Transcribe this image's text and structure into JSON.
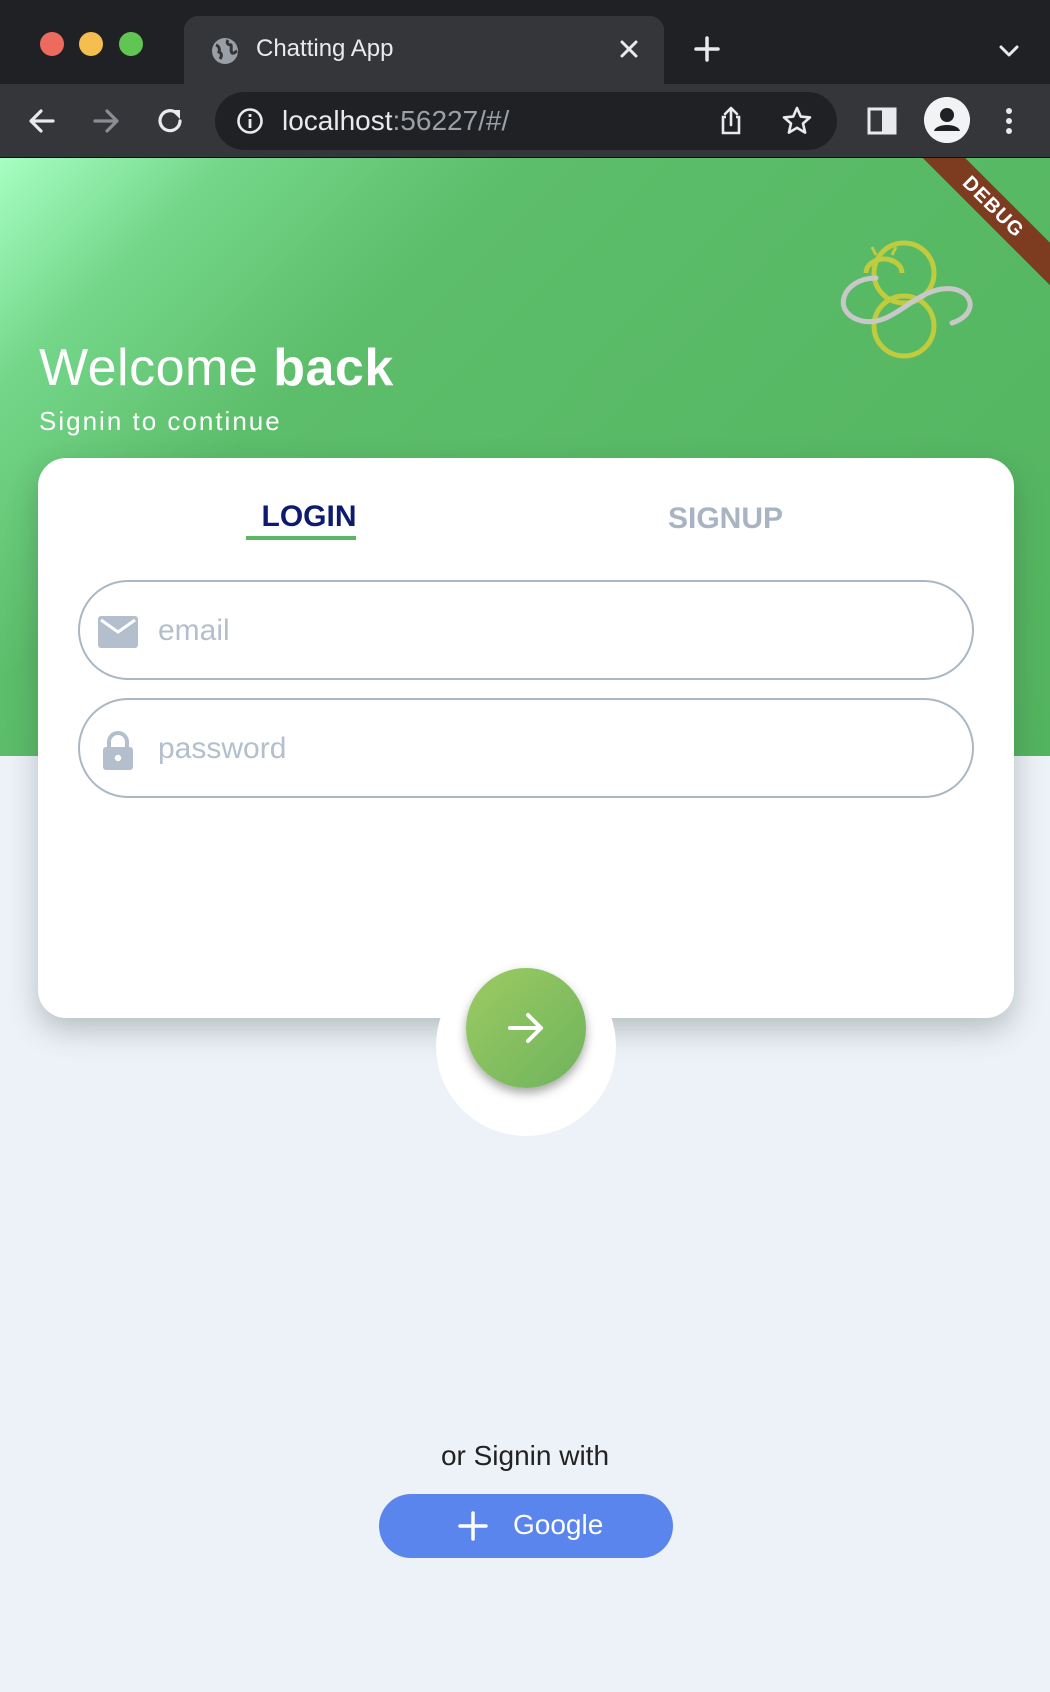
{
  "browser": {
    "tab_title": "Chatting App",
    "url_host": "localhost",
    "url_rest": ":56227/#/",
    "icons": [
      "globe-icon",
      "close-icon",
      "plus-icon",
      "chevron-down-icon",
      "back-icon",
      "forward-icon",
      "reload-icon",
      "info-icon",
      "share-icon",
      "star-icon",
      "sidebar-icon",
      "profile-icon",
      "more-vert-icon"
    ]
  },
  "app": {
    "debug_banner": "DEBUG",
    "welcome_prefix": "Welcome ",
    "welcome_bold": "back",
    "subtitle": "Signin to continue",
    "tabs": {
      "login": "LOGIN",
      "signup": "SIGNUP",
      "active": "login"
    },
    "email": {
      "placeholder": "email",
      "value": ""
    },
    "password": {
      "placeholder": "password",
      "value": ""
    },
    "or_signin_with": "or Signin with",
    "google_button": "Google",
    "colors": {
      "green": "#53b45f",
      "navy": "#0c1b6e",
      "google_blue": "#5a85ec",
      "background": "#edf2f9"
    }
  }
}
